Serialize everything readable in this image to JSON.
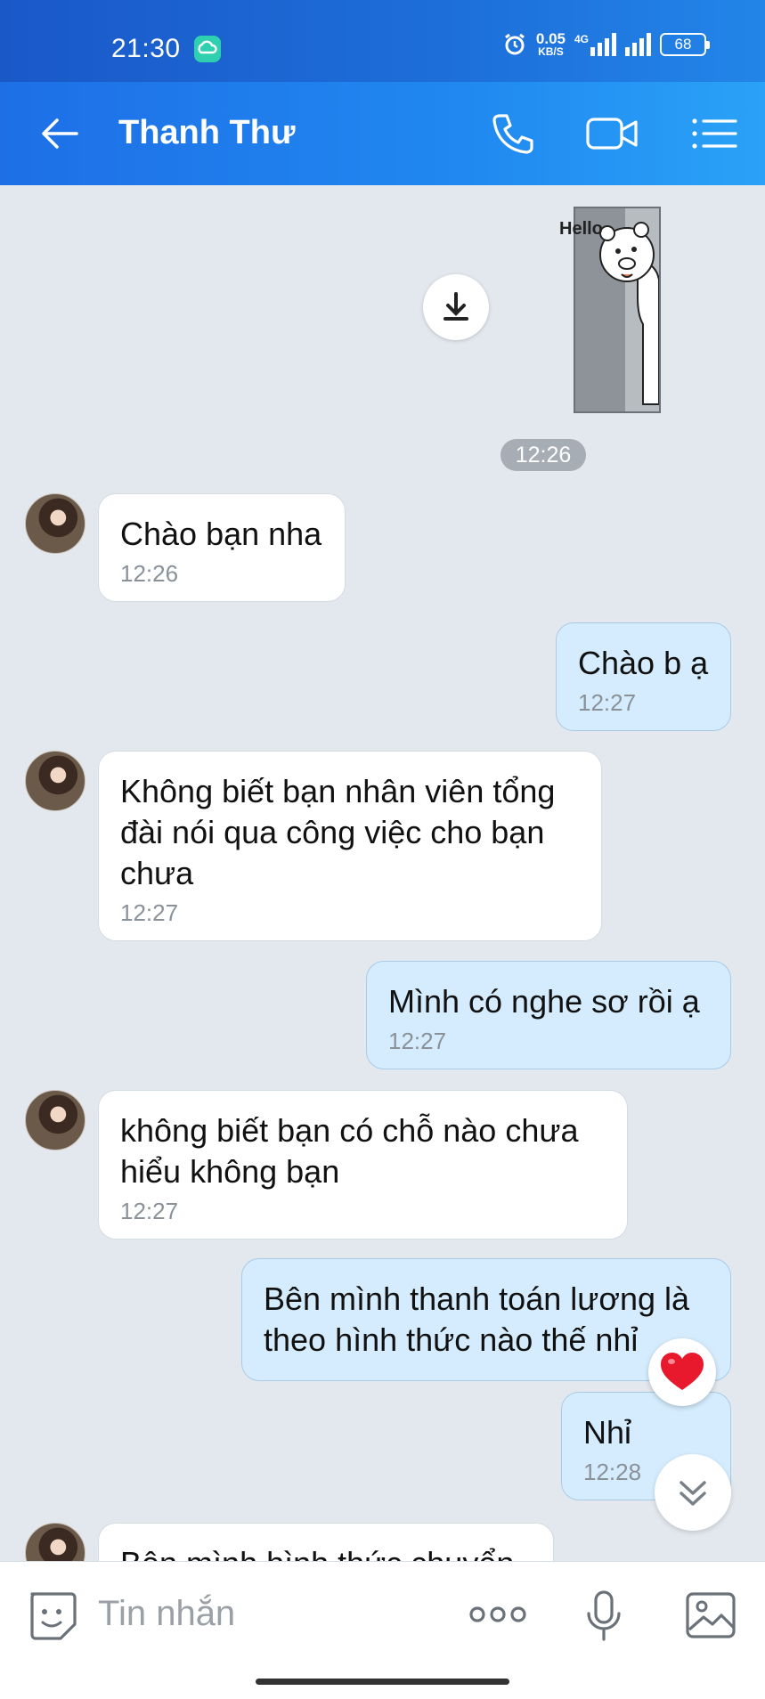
{
  "status_bar": {
    "time": "21:30",
    "net_speed_value": "0.05",
    "net_speed_unit": "KB/S",
    "network": "4G",
    "battery": "68"
  },
  "header": {
    "title": "Thanh Thư",
    "back_icon": "arrow-left-icon",
    "call_icon": "phone-icon",
    "video_icon": "video-camera-icon",
    "menu_icon": "list-menu-icon",
    "background_color": "#1e6fe6"
  },
  "sticker": {
    "text": "Hello",
    "time": "12:26"
  },
  "messages": [
    {
      "direction": "in",
      "text": "Chào bạn nha",
      "time": "12:26"
    },
    {
      "direction": "out",
      "text": "Chào b ạ",
      "time": "12:27"
    },
    {
      "direction": "in",
      "text": "Không biết bạn nhân viên tổng đài nói qua công việc cho bạn chưa",
      "time": "12:27"
    },
    {
      "direction": "out",
      "text": "Mình có nghe sơ rồi ạ",
      "time": "12:27"
    },
    {
      "direction": "in",
      "text": "không biết bạn có chỗ nào chưa hiểu không bạn",
      "time": "12:27"
    },
    {
      "direction": "out",
      "text": "Bên mình thanh toán lương là theo hình thức nào thế nhỉ",
      "time": ""
    },
    {
      "direction": "out",
      "text": "Nhỉ",
      "time": "12:28"
    },
    {
      "direction": "in",
      "text": "Bên mình hình thức chuyển",
      "time": ""
    }
  ],
  "colors": {
    "incoming_bubble": "#ffffff",
    "outgoing_bubble": "#d4ecfd",
    "chat_background": "#e3e8ee"
  },
  "composer": {
    "placeholder": "Tin nhắn",
    "emoji_icon": "emoji-sticker-icon",
    "more_icon": "more-dots-icon",
    "mic_icon": "microphone-icon",
    "image_icon": "image-icon"
  }
}
